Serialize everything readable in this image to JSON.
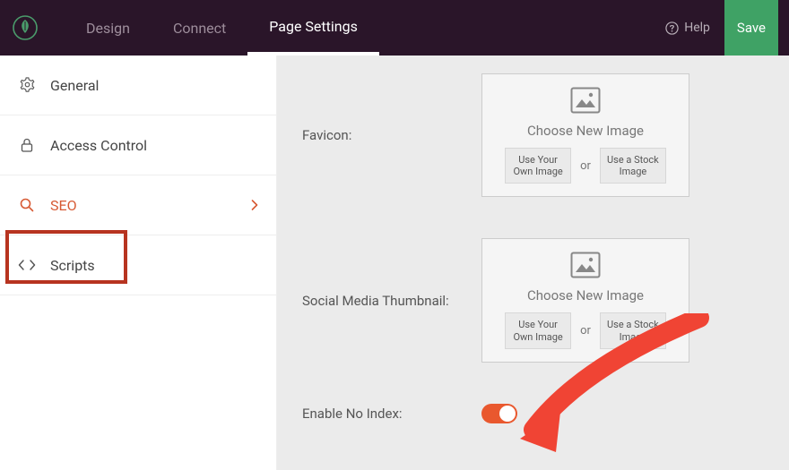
{
  "topbar": {
    "tabs": [
      "Design",
      "Connect",
      "Page Settings"
    ],
    "active_tab": "Page Settings",
    "help_label": "Help",
    "save_label": "Save"
  },
  "sidebar": {
    "items": [
      {
        "icon": "gear",
        "label": "General"
      },
      {
        "icon": "lock",
        "label": "Access Control"
      },
      {
        "icon": "search",
        "label": "SEO",
        "active": true
      },
      {
        "icon": "code",
        "label": "Scripts"
      }
    ]
  },
  "content": {
    "favicon_label": "Favicon:",
    "social_label": "Social Media Thumbnail:",
    "no_index_label": "Enable No Index:",
    "image_picker": {
      "caption": "Choose New Image",
      "own_label": "Use Your Own Image",
      "or": "or",
      "stock_label": "Use a Stock Image"
    },
    "no_index_enabled": true
  },
  "colors": {
    "accent": "#e9582e",
    "topbar_bg": "#2a1529",
    "save_bg": "#3fa265",
    "highlight_border": "#b73420"
  }
}
